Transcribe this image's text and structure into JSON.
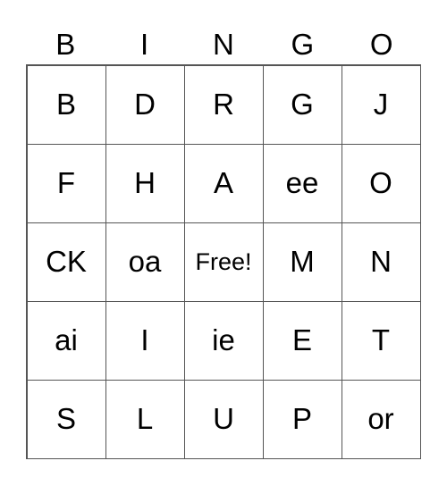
{
  "header": [
    "B",
    "I",
    "N",
    "G",
    "O"
  ],
  "cells": [
    [
      "B",
      "D",
      "R",
      "G",
      "J"
    ],
    [
      "F",
      "H",
      "A",
      "ee",
      "O"
    ],
    [
      "CK",
      "oa",
      "Free!",
      "M",
      "N"
    ],
    [
      "ai",
      "I",
      "ie",
      "E",
      "T"
    ],
    [
      "S",
      "L",
      "U",
      "P",
      "or"
    ]
  ]
}
